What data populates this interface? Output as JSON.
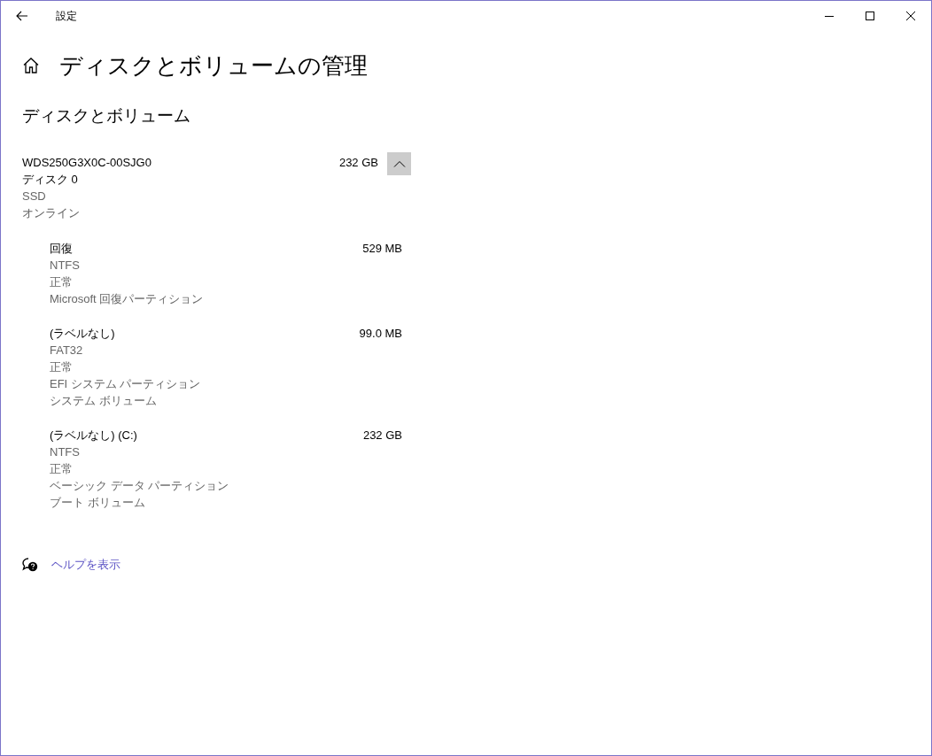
{
  "window": {
    "title": "設定"
  },
  "page_title": "ディスクとボリュームの管理",
  "section_title": "ディスクとボリューム",
  "disk": {
    "name": "WDS250G3X0C-00SJG0",
    "size": "232 GB",
    "expanded": true,
    "label": "ディスク 0",
    "details": [
      "SSD",
      "オンライン"
    ]
  },
  "volumes": [
    {
      "name": "回復",
      "size": "529 MB",
      "details": [
        "NTFS",
        "正常",
        "Microsoft 回復パーティション"
      ]
    },
    {
      "name": "(ラベルなし)",
      "size": "99.0 MB",
      "details": [
        "FAT32",
        "正常",
        "EFI システム パーティション",
        "システム ボリューム"
      ]
    },
    {
      "name": "(ラベルなし) (C:)",
      "size": "232 GB",
      "details": [
        "NTFS",
        "正常",
        "ベーシック データ パーティション",
        "ブート ボリューム"
      ]
    }
  ],
  "help_link": "ヘルプを表示"
}
